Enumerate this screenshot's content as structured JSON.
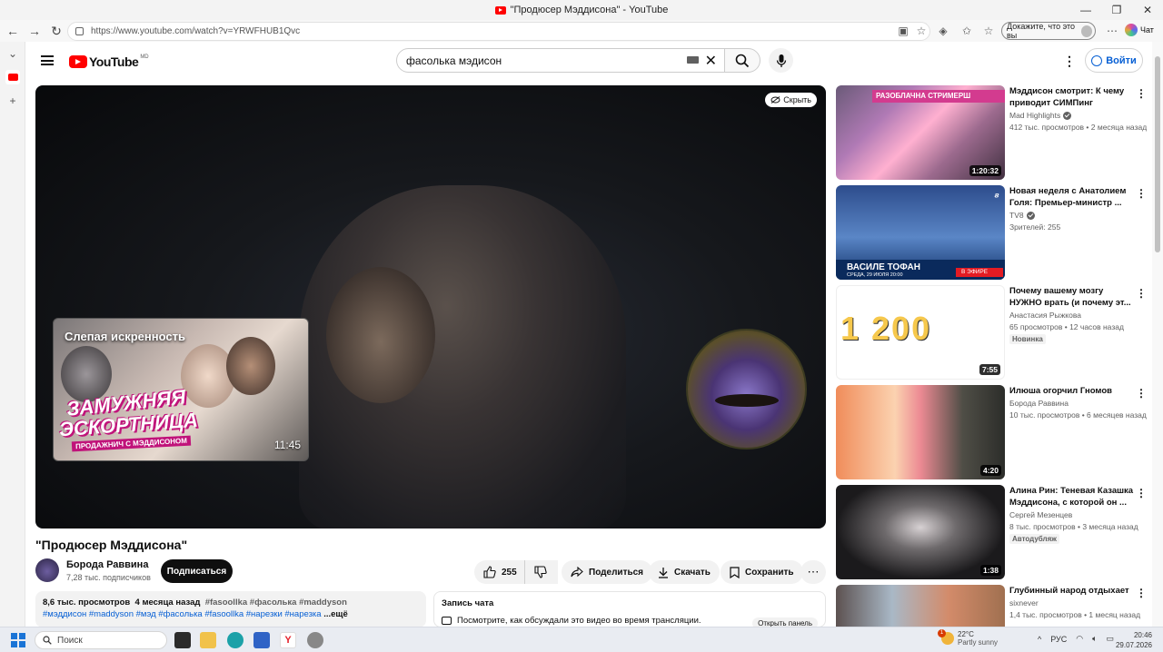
{
  "browser": {
    "tab_title": "\"Продюсер Мэддисона\" - YouTube",
    "url": "https://www.youtube.com/watch?v=YRWFHUB1Qvc",
    "profile_label": "Докажите, что это вы",
    "chat_label": "Чат"
  },
  "header": {
    "logo_text": "YouTube",
    "logo_region": "MD",
    "search_value": "фасолька мэдисон",
    "signin_label": "Войти"
  },
  "player": {
    "hide_label": "Скрыть",
    "endcard": {
      "title": "Слепая искренность",
      "line1": "ЗАМУЖНЯЯ",
      "line2": "ЭСКОРТНИЦА",
      "line3": "ПРОДАЖНИЧ С МЭДДИСОНОМ",
      "duration": "11:45"
    }
  },
  "video": {
    "title": "\"Продюсер Мэддисона\"",
    "channel": "Борода Раввина",
    "subscribers": "7,28 тыс. подписчиков",
    "subscribe_label": "Подписаться",
    "likes": "255",
    "share_label": "Поделиться",
    "download_label": "Скачать",
    "save_label": "Сохранить",
    "description": {
      "views": "8,6 тыс. просмотров",
      "age": "4 месяца назад",
      "tags_line1": "#fasoollka #фасолька #maddyson",
      "tags_line2": "#мэддисон #maddyson #мэд #фасолька #fasoollka #нарезки #нарезка",
      "more_label": "...ещё"
    },
    "chat": {
      "header": "Запись чата",
      "text": "Посмотрите, как обсуждали это видео во время трансляции.",
      "button": "Открыть панель"
    }
  },
  "recommendations": [
    {
      "title": "Мэддисон смотрит: К чему приводит СИМПинг",
      "channel": "Mad Highlights",
      "verified": true,
      "meta": "412 тыс. просмотров • 2 месяца назад",
      "duration": "1:20:32",
      "badge": "",
      "thumb_text": "РАЗОБЛАЧНА СТРИМЕРШ"
    },
    {
      "title": "Новая неделя с Анатолием Голя: Премьер-министр ...",
      "channel": "TV8",
      "verified": true,
      "meta": "Зрителей: 255",
      "duration": "",
      "badge": "",
      "thumb_text": "ВАСИЛЕ ТОФАН",
      "thumb_sub": "СРЕДА, 29 ИЮЛЯ 20:00",
      "live_label": "В ЭФИРЕ"
    },
    {
      "title": "Почему вашему мозгу НУЖНО врать (и почему эт...",
      "channel": "Анастасия Рыжкова",
      "verified": false,
      "meta": "65 просмотров • 12 часов назад",
      "duration": "7:55",
      "badge": "Новинка",
      "thumb_text": "1 200"
    },
    {
      "title": "Илюша огорчил Гномов",
      "channel": "Борода Раввина",
      "verified": false,
      "meta": "10 тыс. просмотров • 6 месяцев назад",
      "duration": "4:20",
      "badge": ""
    },
    {
      "title": "Алина Рин: Теневая Казашка Мэддисона, с которой он ...",
      "channel": "Сергей Мезенцев",
      "verified": false,
      "meta": "8 тыс. просмотров • 3 месяца назад",
      "duration": "1:38",
      "badge": "Автодубляж"
    },
    {
      "title": "Глубинный народ отдыхает",
      "channel": "sixnever",
      "verified": false,
      "meta": "1,4 тыс. просмотров • 1 месяц назад",
      "duration": "",
      "badge": ""
    }
  ],
  "taskbar": {
    "search_placeholder": "Поиск",
    "temperature": "22°C",
    "weather": "Partly sunny",
    "weather_badge": "1",
    "lang": "РУС",
    "time": "20:46",
    "date": "29.07.2026"
  }
}
